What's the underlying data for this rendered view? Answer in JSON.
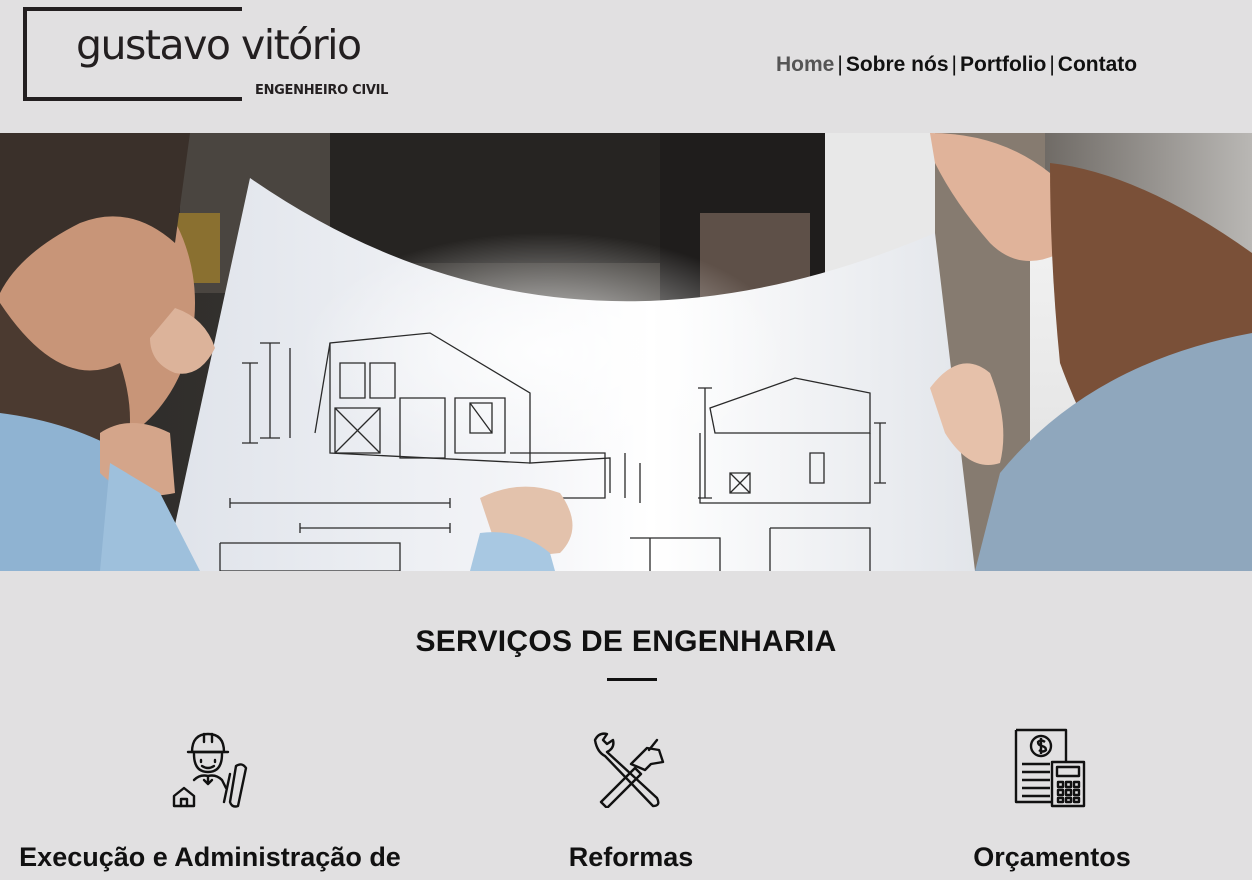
{
  "logo": {
    "name": "gustavo vitório",
    "subtitle": "ENGENHEIRO CIVIL"
  },
  "nav": {
    "items": [
      {
        "label": "Home",
        "active": true
      },
      {
        "label": "Sobre nós",
        "active": false
      },
      {
        "label": "Portfolio",
        "active": false
      },
      {
        "label": "Contato",
        "active": false
      }
    ],
    "separator": "|"
  },
  "services": {
    "title": "SERVIÇOS DE ENGENHARIA",
    "items": [
      {
        "label": "Execução e Administração de",
        "icon": "engineer-icon"
      },
      {
        "label": "Reformas",
        "icon": "tools-icon"
      },
      {
        "label": "Orçamentos",
        "icon": "budget-calculator-icon"
      }
    ]
  },
  "colors": {
    "background": "#e1e0e1",
    "text": "#111111",
    "nav_active": "#555555"
  }
}
